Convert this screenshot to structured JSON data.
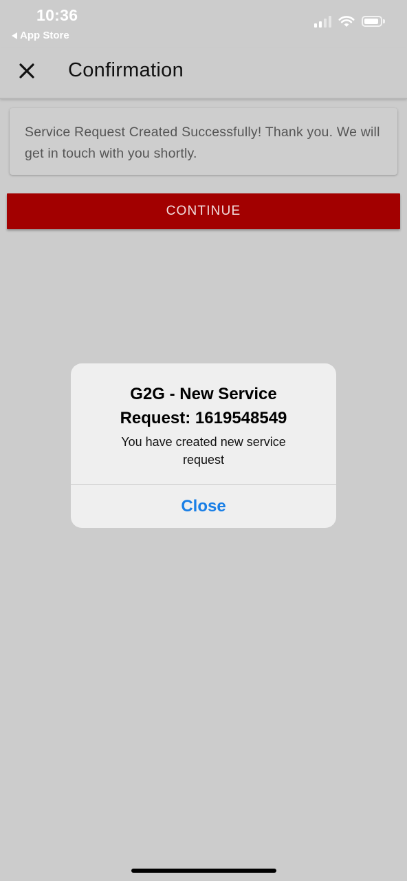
{
  "status_bar": {
    "time": "10:36",
    "back_label": "App Store"
  },
  "header": {
    "title": "Confirmation"
  },
  "message_card": {
    "text": "Service Request Created Successfully! Thank you. We will get in touch with you shortly."
  },
  "continue_button": {
    "label": "CONTINUE"
  },
  "alert": {
    "title": "G2G - New Service Request: 1619548549",
    "message": "You have created new service request",
    "close_label": "Close"
  },
  "colors": {
    "background": "#cccccc",
    "continue_button": "#a20000",
    "alert_action": "#1a7fe6"
  },
  "icons": {
    "close": "close-icon",
    "back": "back-triangle-icon",
    "signal": "cellular-signal-icon",
    "wifi": "wifi-icon",
    "battery": "battery-icon"
  }
}
